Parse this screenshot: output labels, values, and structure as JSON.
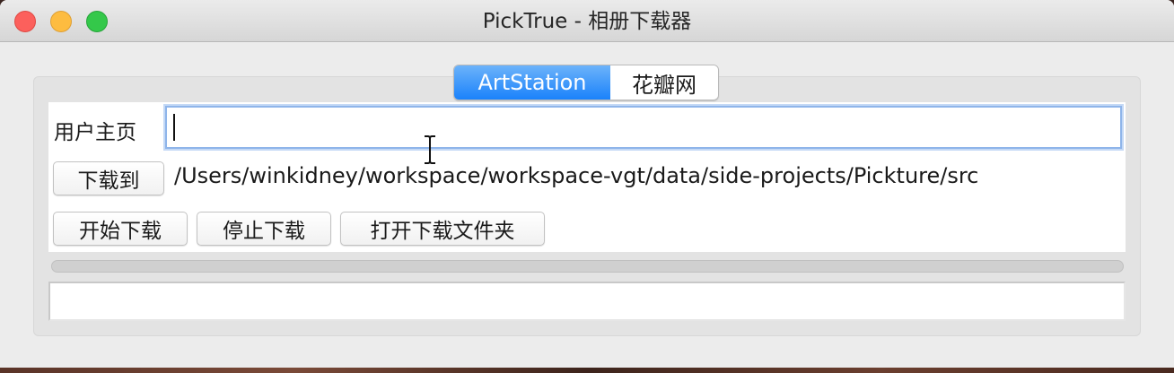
{
  "window": {
    "title": "PickTrue - 相册下载器"
  },
  "tabs": [
    {
      "label": "ArtStation",
      "active": true
    },
    {
      "label": "花瓣网",
      "active": false
    }
  ],
  "form": {
    "homepage_label": "用户主页",
    "homepage_value": "",
    "homepage_placeholder": "",
    "download_to_label": "下载到",
    "download_path": "/Users/winkidney/workspace/workspace-vgt/data/side-projects/Pickture/src"
  },
  "actions": {
    "start_label": "开始下载",
    "stop_label": "停止下载",
    "open_folder_label": "打开下载文件夹"
  },
  "progress": {
    "fraction": 0
  },
  "status": {
    "text": ""
  },
  "colors": {
    "accent": "#1a82fb",
    "close": "#fc605c",
    "minimize": "#fdbc40",
    "maximize": "#34c84a"
  }
}
